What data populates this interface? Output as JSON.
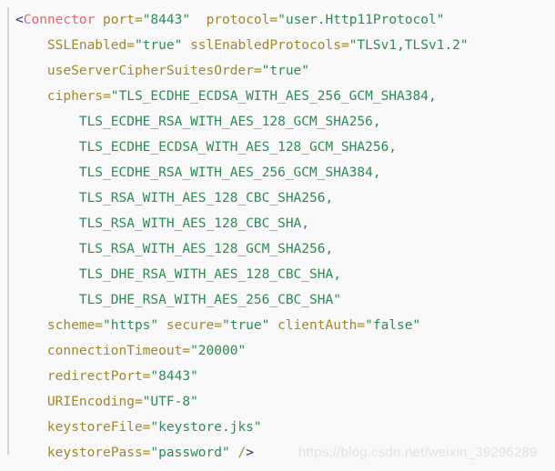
{
  "code_block": {
    "language": "xml",
    "background_color": "#f9f9f9",
    "colors": {
      "punctuation": "#2b2b6e",
      "tag_name": "#e8646a",
      "attribute_name": "#a0862f",
      "attribute_value": "#2f8a55",
      "gutter_rule": "#d4d4d4",
      "watermark": "#e2e2e2"
    },
    "lines": [
      {
        "indent": "",
        "tokens": [
          {
            "type": "punct",
            "text": "<"
          },
          {
            "type": "tag",
            "text": "Connector"
          },
          {
            "type": "plain",
            "text": " "
          },
          {
            "type": "attr",
            "text": "port="
          },
          {
            "type": "value",
            "text": "\"8443\""
          },
          {
            "type": "plain",
            "text": "  "
          },
          {
            "type": "attr",
            "text": "protocol="
          },
          {
            "type": "value",
            "text": "\"user.Http11Protocol\""
          }
        ]
      },
      {
        "indent": "    ",
        "tokens": [
          {
            "type": "attr",
            "text": "SSLEnabled="
          },
          {
            "type": "value",
            "text": "\"true\""
          },
          {
            "type": "plain",
            "text": " "
          },
          {
            "type": "attr",
            "text": "sslEnabledProtocols="
          },
          {
            "type": "value",
            "text": "\"TLSv1,TLSv1.2\""
          }
        ]
      },
      {
        "indent": "    ",
        "tokens": [
          {
            "type": "attr",
            "text": "useServerCipherSuitesOrder="
          },
          {
            "type": "value",
            "text": "\"true\""
          }
        ]
      },
      {
        "indent": "    ",
        "tokens": [
          {
            "type": "attr",
            "text": "ciphers="
          },
          {
            "type": "value",
            "text": "\"TLS_ECDHE_ECDSA_WITH_AES_256_GCM_SHA384,"
          }
        ]
      },
      {
        "indent": "        ",
        "tokens": [
          {
            "type": "value",
            "text": "TLS_ECDHE_RSA_WITH_AES_128_GCM_SHA256,"
          }
        ]
      },
      {
        "indent": "        ",
        "tokens": [
          {
            "type": "value",
            "text": "TLS_ECDHE_ECDSA_WITH_AES_128_GCM_SHA256,"
          }
        ]
      },
      {
        "indent": "        ",
        "tokens": [
          {
            "type": "value",
            "text": "TLS_ECDHE_RSA_WITH_AES_256_GCM_SHA384,"
          }
        ]
      },
      {
        "indent": "        ",
        "tokens": [
          {
            "type": "value",
            "text": "TLS_RSA_WITH_AES_128_CBC_SHA256,"
          }
        ]
      },
      {
        "indent": "        ",
        "tokens": [
          {
            "type": "value",
            "text": "TLS_RSA_WITH_AES_128_CBC_SHA,"
          }
        ]
      },
      {
        "indent": "        ",
        "tokens": [
          {
            "type": "value",
            "text": "TLS_RSA_WITH_AES_128_GCM_SHA256,"
          }
        ]
      },
      {
        "indent": "        ",
        "tokens": [
          {
            "type": "value",
            "text": "TLS_DHE_RSA_WITH_AES_128_CBC_SHA,"
          }
        ]
      },
      {
        "indent": "        ",
        "tokens": [
          {
            "type": "value",
            "text": "TLS_DHE_RSA_WITH_AES_256_CBC_SHA\""
          }
        ]
      },
      {
        "indent": "    ",
        "tokens": [
          {
            "type": "attr",
            "text": "scheme="
          },
          {
            "type": "value",
            "text": "\"https\""
          },
          {
            "type": "plain",
            "text": " "
          },
          {
            "type": "attr",
            "text": "secure="
          },
          {
            "type": "value",
            "text": "\"true\""
          },
          {
            "type": "plain",
            "text": " "
          },
          {
            "type": "attr",
            "text": "clientAuth="
          },
          {
            "type": "value",
            "text": "\"false\""
          }
        ]
      },
      {
        "indent": "    ",
        "tokens": [
          {
            "type": "attr",
            "text": "connectionTimeout="
          },
          {
            "type": "value",
            "text": "\"20000\""
          }
        ]
      },
      {
        "indent": "    ",
        "tokens": [
          {
            "type": "attr",
            "text": "redirectPort="
          },
          {
            "type": "value",
            "text": "\"8443\""
          }
        ]
      },
      {
        "indent": "    ",
        "tokens": [
          {
            "type": "attr",
            "text": "URIEncoding="
          },
          {
            "type": "value",
            "text": "\"UTF-8\""
          }
        ]
      },
      {
        "indent": "    ",
        "tokens": [
          {
            "type": "attr",
            "text": "keystoreFile="
          },
          {
            "type": "value",
            "text": "\"keystore.jks\""
          }
        ]
      },
      {
        "indent": "    ",
        "tokens": [
          {
            "type": "attr",
            "text": "keystorePass="
          },
          {
            "type": "value",
            "text": "\"password\""
          },
          {
            "type": "plain",
            "text": " "
          },
          {
            "type": "attr",
            "text": "/"
          },
          {
            "type": "punct",
            "text": ">"
          }
        ]
      }
    ]
  },
  "watermark": {
    "text": "https://blog.csdn.net/weixin_39296289"
  }
}
